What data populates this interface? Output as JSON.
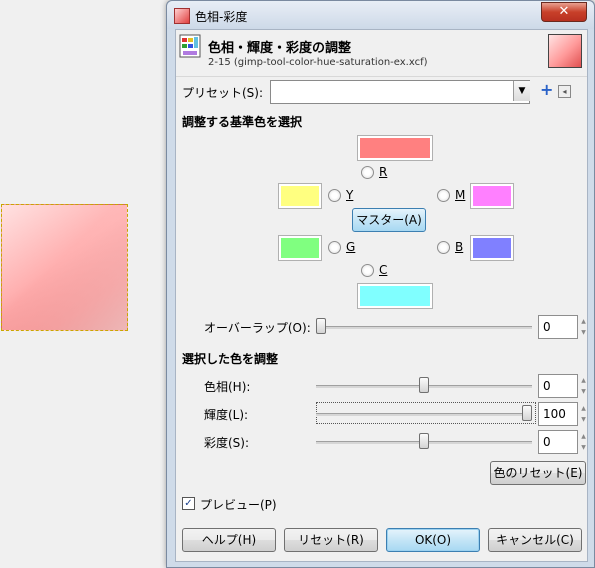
{
  "window": {
    "title": "色相-彩度",
    "close_label": "✕"
  },
  "header": {
    "title": "色相・輝度・彩度の調整",
    "subtitle": "2-15 (gimp-tool-color-hue-saturation-ex.xcf)"
  },
  "presets": {
    "label": "プリセット(S):",
    "value": ""
  },
  "primary_section": {
    "title": "調整する基準色を選択",
    "master_label": "マスター(A)",
    "selected": "master",
    "colors": [
      {
        "key": "R",
        "label": "R",
        "hex": "#ff8080"
      },
      {
        "key": "Y",
        "label": "Y",
        "hex": "#ffff80"
      },
      {
        "key": "G",
        "label": "G",
        "hex": "#80ff80"
      },
      {
        "key": "C",
        "label": "C",
        "hex": "#80ffff"
      },
      {
        "key": "B",
        "label": "B",
        "hex": "#8080ff"
      },
      {
        "key": "M",
        "label": "M",
        "hex": "#ff80ff"
      }
    ]
  },
  "overlap": {
    "label": "オーバーラップ(O):",
    "value": "0",
    "fraction": 0.0
  },
  "adjust_section": {
    "title": "選択した色を調整",
    "rows": [
      {
        "label": "色相(H):",
        "value": "0",
        "fraction": 0.5
      },
      {
        "label": "輝度(L):",
        "value": "100",
        "fraction": 1.0
      },
      {
        "label": "彩度(S):",
        "value": "0",
        "fraction": 0.5
      }
    ],
    "reset_color_label": "色のリセット(E)"
  },
  "preview": {
    "label": "プレビュー(P)",
    "checked": true,
    "check_glyph": "✓"
  },
  "buttons": {
    "help": "ヘルプ(H)",
    "reset": "リセット(R)",
    "ok": "OK(O)",
    "cancel": "キャンセル(C)"
  },
  "icons": {
    "preset_add": "+",
    "preset_menu": "◂",
    "combo_arrow": "▼",
    "spin_up": "▲",
    "spin_down": "▼"
  }
}
